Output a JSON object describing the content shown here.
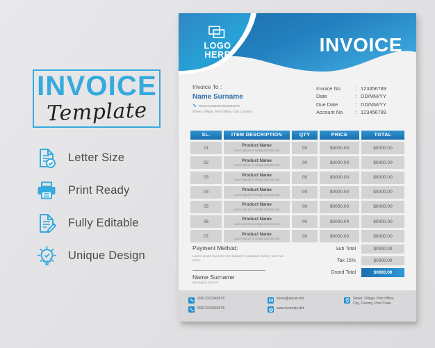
{
  "promo": {
    "title_main": "INVOICE",
    "title_sub": "Template",
    "features": [
      {
        "icon": "document-check-icon",
        "label": "Letter Size"
      },
      {
        "icon": "printer-icon",
        "label": "Print Ready"
      },
      {
        "icon": "document-edit-icon",
        "label": "Fully Editable"
      },
      {
        "icon": "lightbulb-check-icon",
        "label": "Unique Design"
      }
    ]
  },
  "invoice": {
    "header": {
      "logo_line1": "LOGO",
      "logo_line2": "HERE",
      "logo_icon": "layers-icon",
      "title": "INVOICE"
    },
    "bill_to": {
      "label": "Invoice To :",
      "name": "Name Surname",
      "phone_icon": "phone-icon",
      "phone": "00012312345678912345678",
      "address": "Street, Village, Post Office, City, Country"
    },
    "meta": [
      {
        "key": "Invoice No",
        "sep": ":",
        "value": "123456789"
      },
      {
        "key": "Date",
        "sep": ":",
        "value": "DD/MM/YY"
      },
      {
        "key": "Due Date",
        "sep": ":",
        "value": "DD/MM/YY"
      },
      {
        "key": "Account No",
        "sep": ":",
        "value": "123456789"
      }
    ],
    "table": {
      "columns": [
        "SL.",
        "ITEM DESCRIPTION",
        "QTY",
        "PRICE",
        "TOTAL"
      ],
      "rows": [
        {
          "sl": "01",
          "name": "Product Name",
          "desc": "Lorem ipsum is simply dummy text",
          "qty": "00",
          "price": "$0000.00",
          "total": "$0000.00"
        },
        {
          "sl": "02",
          "name": "Product Name",
          "desc": "Lorem ipsum is simply dummy text",
          "qty": "00",
          "price": "$0000.00",
          "total": "$0000.00"
        },
        {
          "sl": "03",
          "name": "Product Name",
          "desc": "Lorem ipsum is simply dummy text",
          "qty": "00",
          "price": "$0000.00",
          "total": "$0000.00"
        },
        {
          "sl": "04",
          "name": "Product Name",
          "desc": "Lorem ipsum is simply dummy text",
          "qty": "00",
          "price": "$0000.00",
          "total": "$0000.00"
        },
        {
          "sl": "05",
          "name": "Product Name",
          "desc": "Lorem ipsum is simply dummy text",
          "qty": "00",
          "price": "$0000.00",
          "total": "$0000.00"
        },
        {
          "sl": "06",
          "name": "Product Name",
          "desc": "Lorem ipsum is simply dummy text",
          "qty": "00",
          "price": "$0000.00",
          "total": "$0000.00"
        },
        {
          "sl": "07",
          "name": "Product Name",
          "desc": "Lorem ipsum is simply dummy text",
          "qty": "00",
          "price": "$0000.00",
          "total": "$0000.00"
        }
      ]
    },
    "totals": [
      {
        "key": "Sub Total",
        "value": "$0000.00",
        "highlight": false
      },
      {
        "key": "Tax 15%",
        "value": "$0000.00",
        "highlight": false
      },
      {
        "key": "Grand Total",
        "value": "$0000.00",
        "highlight": true
      }
    ],
    "payment": {
      "title": "Payment Method:",
      "desc": "Lorem ipsum has been the industry's standard dummy text ever since."
    },
    "signature": {
      "name": "Name Surname",
      "role": "Managing Director"
    },
    "footer": {
      "phone1": "00012312345678",
      "phone2": "00012312345678",
      "email": "lorem@ipsum.dot",
      "web": "www.loremips.dot",
      "address_line1": "Street, Village, Post Office,",
      "address_line2": "City, Country, Post Code",
      "icons": [
        "phone-icon",
        "phone-icon",
        "mail-icon",
        "globe-icon",
        "location-icon"
      ]
    }
  },
  "colors": {
    "accent_blue": "#36a9dd",
    "deep_blue": "#1a6fae",
    "mid_blue": "#2b8fcd",
    "page_bg": "#e3e3e5",
    "sheet_bg": "#f2f2f2",
    "row_gray": "#d3d3d3"
  }
}
